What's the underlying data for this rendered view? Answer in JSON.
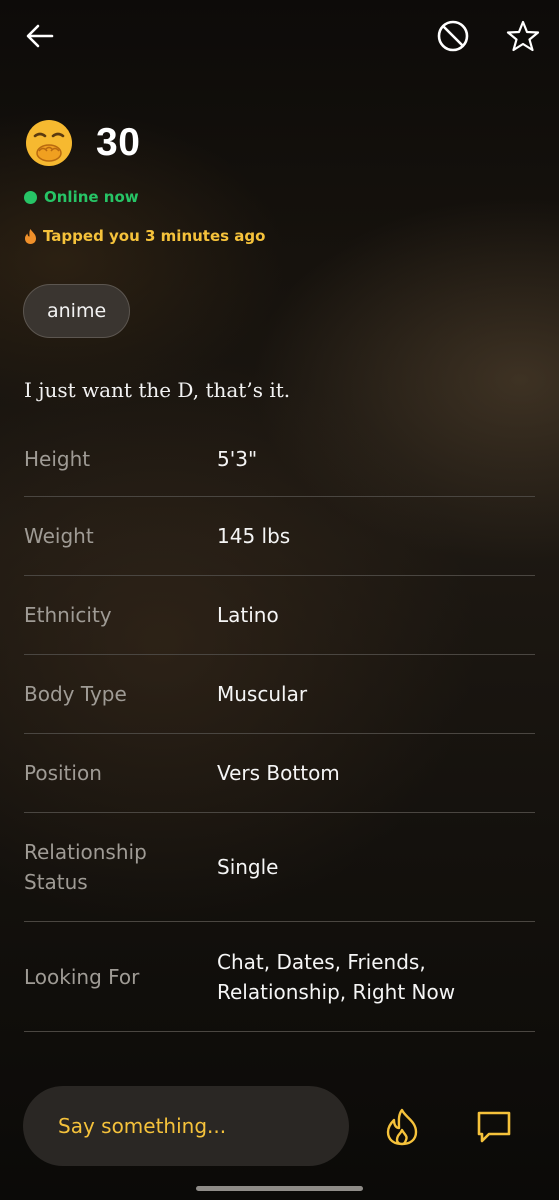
{
  "profile": {
    "age": "30",
    "status": "Online now",
    "tapped": "Tapped you 3 minutes ago",
    "tag": "anime",
    "bio": "I just want the D, that’s it."
  },
  "stats": [
    {
      "label": "Height",
      "value": "5'3\""
    },
    {
      "label": "Weight",
      "value": "145 lbs"
    },
    {
      "label": "Ethnicity",
      "value": "Latino"
    },
    {
      "label": "Body Type",
      "value": "Muscular"
    },
    {
      "label": "Position",
      "value": "Vers Bottom"
    },
    {
      "label": "Relationship Status",
      "value": "Single"
    },
    {
      "label": "Looking For",
      "value": "Chat, Dates, Friends, Relationship, Right Now"
    }
  ],
  "composer": {
    "placeholder": "Say something..."
  },
  "icons": {
    "back": "back-arrow-icon",
    "block": "block-icon",
    "favorite": "star-icon",
    "emoji": "face-with-hand-over-mouth-emoji",
    "tap": "flame-icon",
    "chat": "chat-bubble-icon"
  },
  "colors": {
    "online": "#27c466",
    "accent": "#f5c23b",
    "background": "#14110d"
  }
}
